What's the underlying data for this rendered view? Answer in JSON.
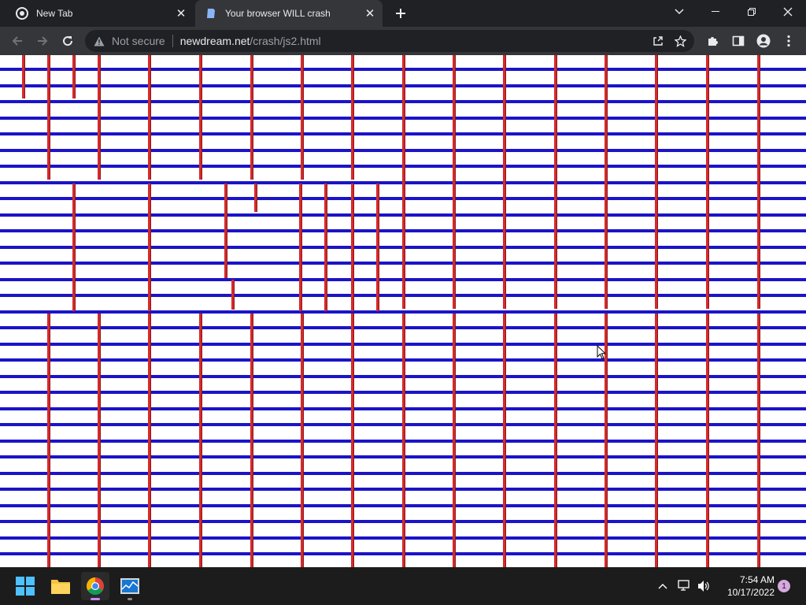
{
  "browser": {
    "tabs": [
      {
        "title": "New Tab",
        "active": false,
        "icon": "chrome-icon"
      },
      {
        "title": "Your browser WILL crash",
        "active": true,
        "icon": "page-icon"
      }
    ],
    "new_tab_icon": "plus-icon",
    "address": {
      "security_label": "Not secure",
      "host": "newdream.net",
      "path": "/crash/js2.html"
    }
  },
  "taskbar": {
    "time": "7:54 AM",
    "date": "10/17/2022",
    "notification_count": "1"
  },
  "colors": {
    "bar_red": "#d52b2b",
    "bar_blue": "#1a14c8",
    "accent": "#c58af9"
  }
}
